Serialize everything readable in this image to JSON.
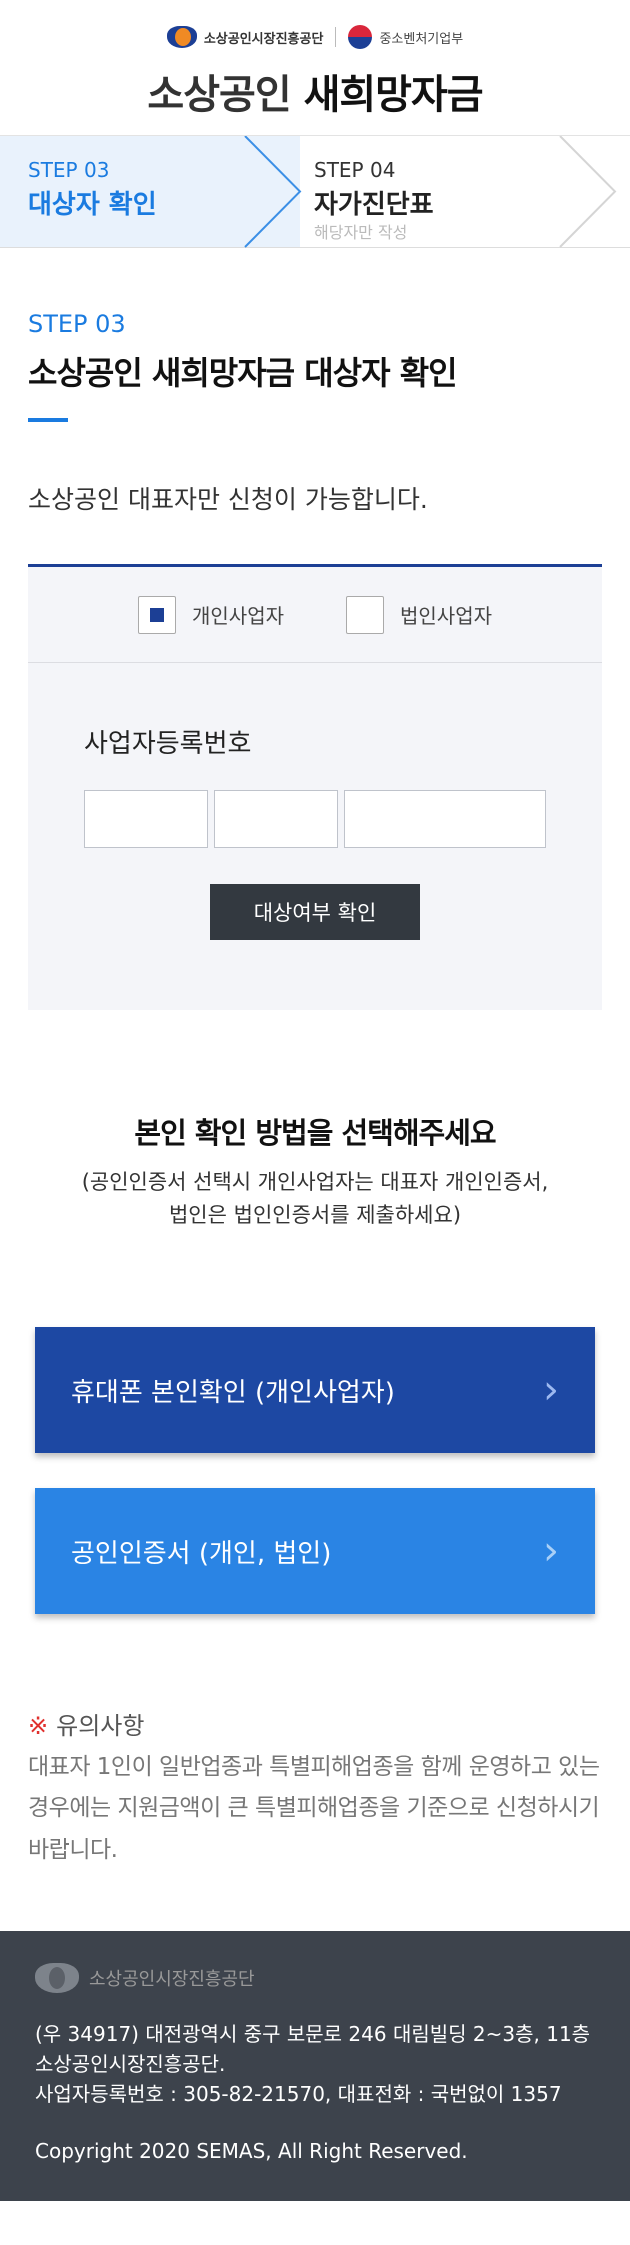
{
  "header": {
    "org1": "소상공인시장진흥공단",
    "org2": "중소벤처기업부",
    "title_light": "소상공인",
    "title_bold": "새희망자금"
  },
  "steps": [
    {
      "num": "STEP 03",
      "label": "대상자 확인",
      "active": true
    },
    {
      "num": "STEP 04",
      "label": "자가진단표",
      "sub": "해당자만 작성",
      "active": false
    }
  ],
  "section": {
    "step": "STEP 03",
    "title": "소상공인 새희망자금 대상자 확인",
    "desc": "소상공인 대표자만 신청이 가능합니다."
  },
  "form": {
    "options": [
      {
        "label": "개인사업자",
        "checked": true
      },
      {
        "label": "법인사업자",
        "checked": false
      }
    ],
    "field_label": "사업자등록번호",
    "check_button": "대상여부 확인"
  },
  "verify": {
    "title": "본인 확인 방법을 선택해주세요",
    "note_line1": "(공인인증서 선택시 개인사업자는 대표자 개인인증서,",
    "note_line2": "법인은 법인인증서를 제출하세요)",
    "phone_button": "휴대폰 본인확인 (개인사업자)",
    "cert_button": "공인인증서 (개인, 법인)"
  },
  "notice": {
    "mark": "※",
    "title": "유의사항",
    "text": "대표자 1인이 일반업종과 특별피해업종을 함께 운영하고 있는 경우에는 지원금액이 큰 특별피해업종을 기준으로 신청하시기 바랍니다."
  },
  "footer": {
    "org": "소상공인시장진흥공단",
    "address": "(우 34917) 대전광역시 중구 보문로 246 대림빌딩 2~3층, 11층 소상공인시장진흥공단.",
    "biz_info": "사업자등록번호 : 305-82-21570, 대표전화 : 국번없이 1357",
    "copyright": "Copyright 2020 SEMAS, All Right Reserved."
  },
  "colors": {
    "primary": "#1a7be0",
    "navy": "#1c3f95",
    "phone_button": "#1d48a3",
    "cert_button": "#2a84e4",
    "footer_bg": "#3d434c"
  },
  "icons": [
    "semas-logo-icon",
    "mss-logo-icon",
    "chevron-right-icon"
  ]
}
